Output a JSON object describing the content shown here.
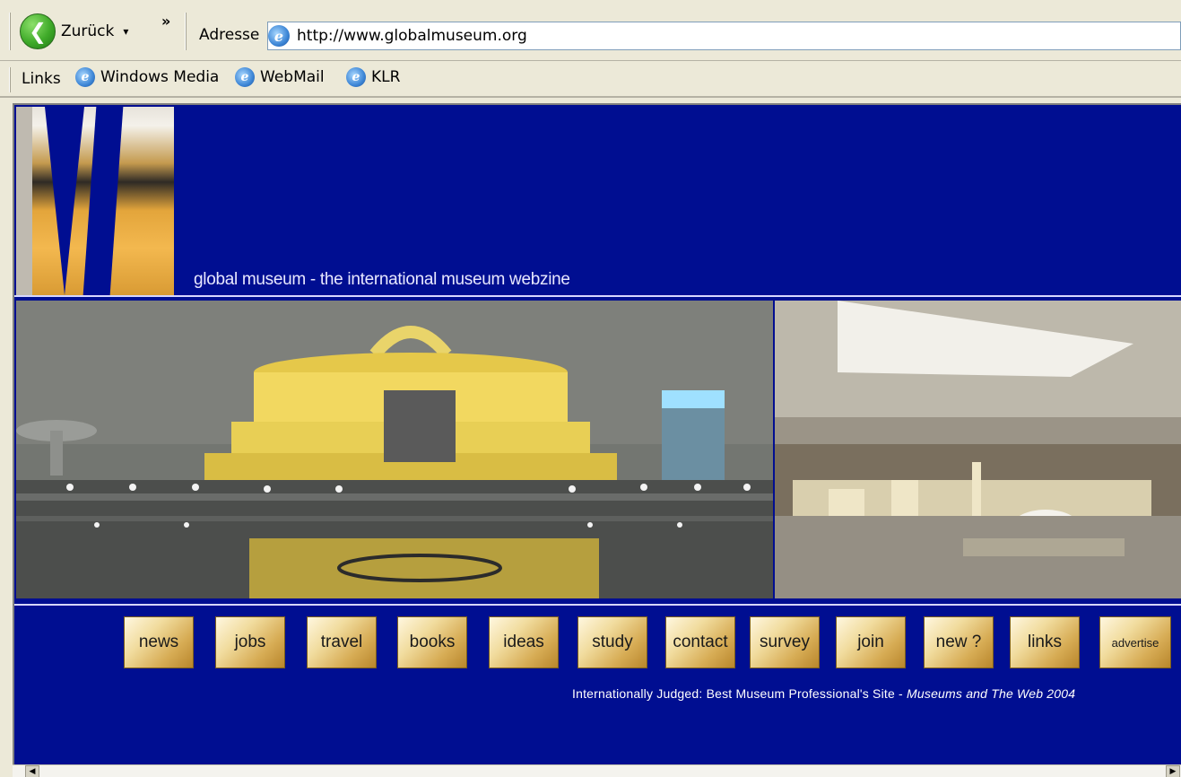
{
  "browser": {
    "back_label": "Zurück",
    "address_label": "Adresse",
    "url": "http://www.globalmuseum.org",
    "links_label": "Links",
    "links": [
      {
        "label": "Windows Media"
      },
      {
        "label": "WebMail"
      },
      {
        "label": "KLR"
      }
    ]
  },
  "page": {
    "tagline": "global museum - the international museum webzine",
    "nav": [
      {
        "label": "news"
      },
      {
        "label": "jobs"
      },
      {
        "label": "travel"
      },
      {
        "label": "books"
      },
      {
        "label": "ideas"
      },
      {
        "label": "study"
      },
      {
        "label": "contact"
      },
      {
        "label": "survey"
      },
      {
        "label": "join"
      },
      {
        "label": "new ?"
      },
      {
        "label": "links"
      },
      {
        "label": "advertise"
      }
    ],
    "award_text": "Internationally Judged: Best Museum Professional's Site - ",
    "award_source": "Museums and The Web 2004"
  },
  "colors": {
    "page_background": "#000e91",
    "button_gold": "#d7ac55"
  }
}
